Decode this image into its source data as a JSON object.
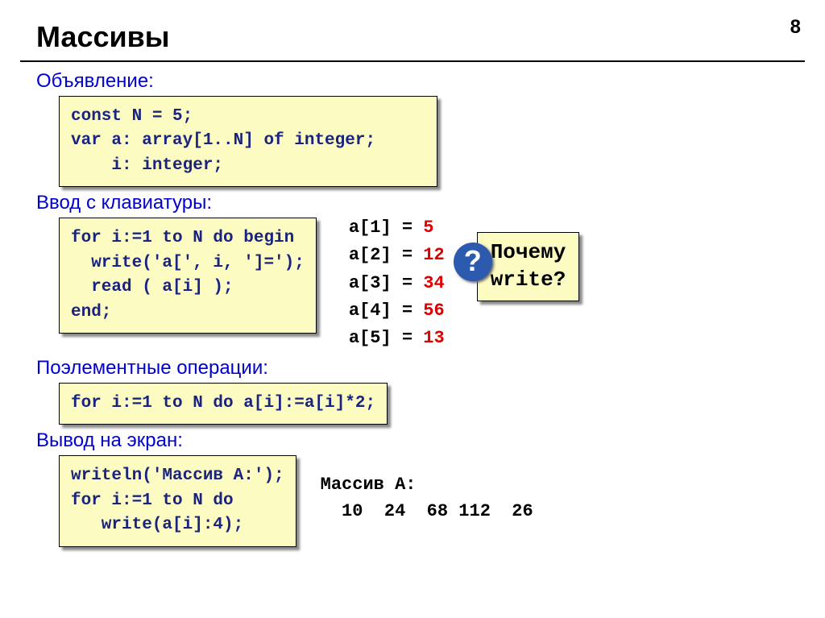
{
  "page_number": "8",
  "title": "Массивы",
  "sections": {
    "declaration": {
      "label": "Объявление:",
      "code": "const N = 5;\nvar a: array[1..N] of integer;\n    i: integer;"
    },
    "input": {
      "label": "Ввод с клавиатуры:",
      "code": "for i:=1 to N do begin\n  write('a[', i, ']=');\n  read ( a[i] );\nend;"
    },
    "operations": {
      "label": "Поэлементные операции:",
      "code": "for i:=1 to N do a[i]:=a[i]*2;"
    },
    "output": {
      "label": "Вывод на экран:",
      "code": "writeln('Массив A:');\nfor i:=1 to N do \n   write(a[i]:4);"
    }
  },
  "array_values": [
    {
      "lhs": "a[1] = ",
      "rhs": "5"
    },
    {
      "lhs": "a[2] = ",
      "rhs": "12"
    },
    {
      "lhs": "a[3] = ",
      "rhs": "34"
    },
    {
      "lhs": "a[4] = ",
      "rhs": "56"
    },
    {
      "lhs": "a[5] = ",
      "rhs": "13"
    }
  ],
  "callout": {
    "line1": "Почему",
    "line2": "write?"
  },
  "program_output": {
    "line1": "Массив A:",
    "line2": "  10  24  68 112  26"
  }
}
